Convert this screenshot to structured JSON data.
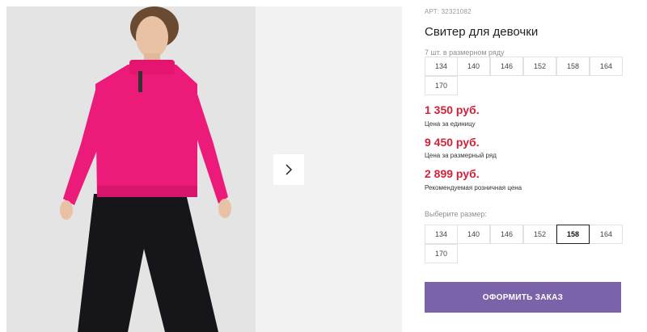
{
  "product": {
    "article": "АРТ: 32321082",
    "title": "Свитер для девочки",
    "sizes_in_row_note": "7 шт. в размерном ряду",
    "size_row": [
      "134",
      "140",
      "146",
      "152",
      "158",
      "164",
      "170"
    ]
  },
  "prices": {
    "unit_price": "1 350 руб.",
    "unit_label": "Цена за единицу",
    "row_price": "9 450 руб.",
    "row_label": "Цена за размерный ряд",
    "retail_price": "2 899 руб.",
    "retail_label": "Рекомендуемая розничная цена",
    "price_color": "#d4213a"
  },
  "size_select": {
    "label": "Выберите размер:",
    "options": [
      "134",
      "140",
      "146",
      "152",
      "158",
      "164",
      "170"
    ],
    "selected": "158"
  },
  "order": {
    "button_label": "ОФОРМИТЬ ЗАКАЗ",
    "button_color": "#7b63a9"
  },
  "gallery": {
    "next_icon": "chevron-right-icon"
  }
}
